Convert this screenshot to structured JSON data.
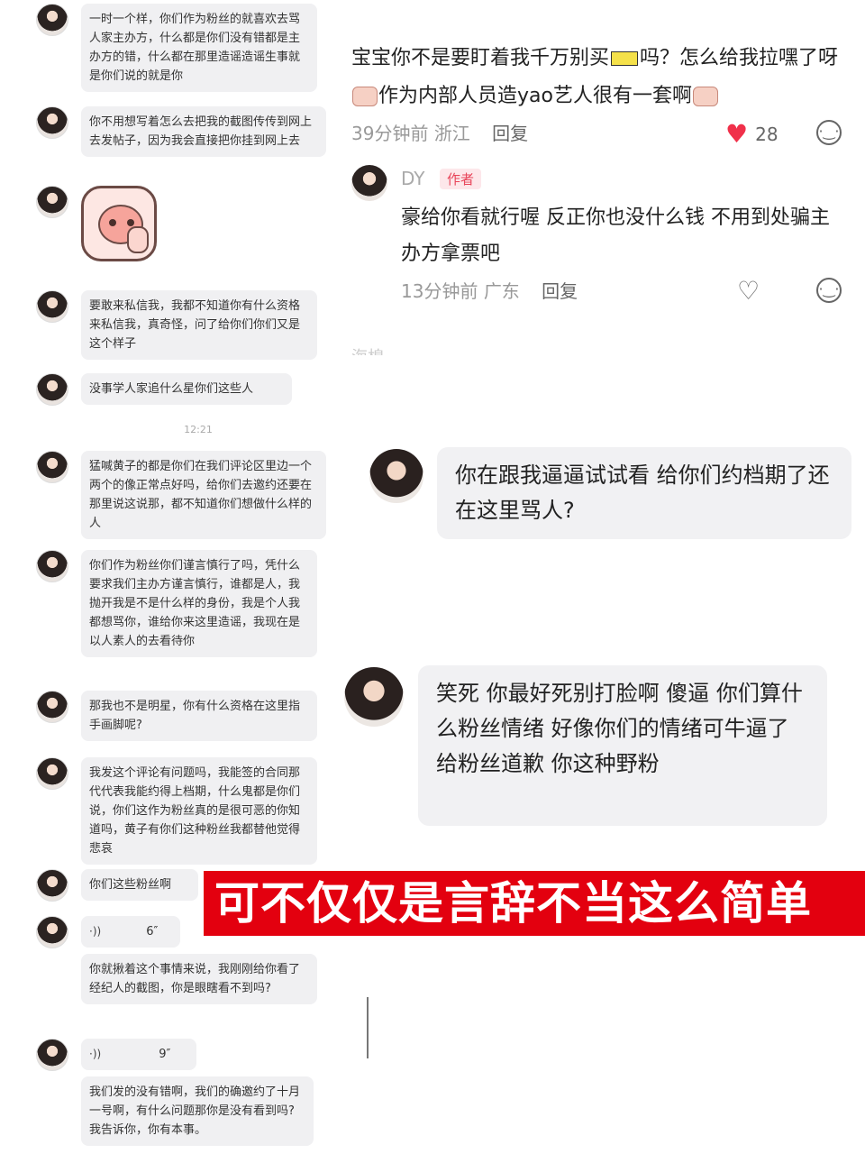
{
  "left_chat": {
    "messages": [
      {
        "type": "text",
        "text": "一时一个样，你们作为粉丝的就喜欢去骂人家主办方，什么都是你们没有错都是主办方的错，什么都在那里造谣造谣生事就是你们说的就是你"
      },
      {
        "type": "text",
        "text": "你不用想写着怎么去把我的截图传传到网上去发帖子，因为我会直接把你挂到网上去"
      },
      {
        "type": "sticker",
        "icon": "cute-sheep-sticker"
      },
      {
        "type": "text",
        "text": "要敢来私信我，我都不知道你有什么资格来私信我，真奇怪，问了给你们你们又是这个样子"
      },
      {
        "type": "text",
        "text": "没事学人家追什么星你们这些人"
      },
      {
        "type": "text",
        "text": "猛喊黄子的都是你们在我们评论区里边一个两个的像正常点好吗，给你们去邀约还要在那里说这说那，都不知道你们想做什么样的人"
      },
      {
        "type": "text",
        "text": "你们作为粉丝你们谨言慎行了吗，凭什么要求我们主办方谨言慎行，谁都是人，我抛开我是不是什么样的身份，我是个人我都想骂你，谁给你来这里造谣，我现在是以人素人的去看待你"
      },
      {
        "type": "text",
        "text": "那我也不是明星，你有什么资格在这里指手画脚呢?"
      },
      {
        "type": "text",
        "text": "我发这个评论有问题吗，我能签的合同那代代表我能约得上档期，什么鬼都是你们说，你们这作为粉丝真的是很可恶的你知道吗，黄子有你们这种粉丝我都替他觉得悲哀"
      },
      {
        "type": "text",
        "text": "你们这些粉丝啊"
      },
      {
        "type": "voice",
        "duration": "6″"
      },
      {
        "type": "text",
        "text": "你就揪着这个事情来说，我刚刚给你看了经纪人的截图，你是眼瞎看不到吗?"
      },
      {
        "type": "voice",
        "duration": "9″"
      },
      {
        "type": "text",
        "text": "我们发的没有错啊，我们的确邀约了十月一号啊，有什么问题那你是没有看到吗? 我告诉你，你有本事。"
      }
    ],
    "timestamp": "12:21"
  },
  "comment": {
    "part1": "宝宝你不是要盯着我千万别买",
    "part2": "吗？怎么给我拉嘿了呀",
    "part3": "作为内部人员造yao艺人很有一套啊",
    "time": "39分钟前",
    "location": "浙江",
    "reply_label": "回复",
    "likes": "28"
  },
  "author_reply": {
    "name": "DY",
    "tag": "作者",
    "text": "豪给你看就行喔 反正你也没什么钱 不用到处骗主办方拿票吧",
    "time": "13分钟前",
    "location": "广东",
    "reply_label": "回复"
  },
  "cut_text": "海棉",
  "right_chat": {
    "bubble1": "你在跟我逼逼试试看 给你们约档期了还在这里骂人?",
    "bubble2": "笑死 你最好死别打脸啊 傻逼 你们算什么粉丝情绪 好像你们的情绪可牛逼了 给粉丝道歉 你这种野粉"
  },
  "banner": {
    "text": "可不仅仅是言辞不当这么简单",
    "color": "#e3000f"
  }
}
